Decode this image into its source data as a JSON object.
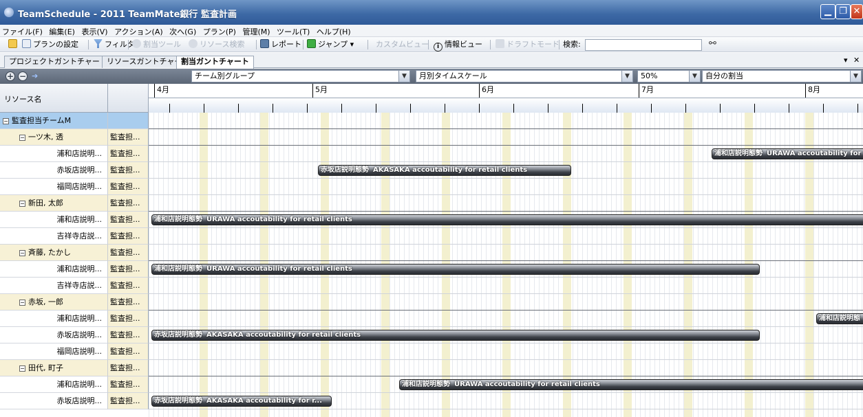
{
  "window": {
    "title": "TeamSchedule - 2011 TeamMate銀行 監査計画"
  },
  "menu": [
    "ファイル(F)",
    "編集(E)",
    "表示(V)",
    "アクション(A)",
    "次へ(G)",
    "プラン(P)",
    "管理(M)",
    "ツール(T)",
    "ヘルプ(H)"
  ],
  "toolbar": {
    "plan_settings": "プランの設定",
    "filter": "フィルタ",
    "allocation_tool": "割当ツール",
    "resource_search": "リソース検索",
    "report": "レポート",
    "jump": "ジャンプ ▾",
    "custom_view": "カスタムビュー",
    "info_view": "情報ビュー",
    "draft_mode": "ドラフトモード",
    "search_label": "検索:",
    "search_value": ""
  },
  "tabs": [
    {
      "label": "プロジェクトガントチャート"
    },
    {
      "label": "リソースガントチャート"
    },
    {
      "label": "割当ガントチャート"
    }
  ],
  "options": {
    "group": "チーム別グループ",
    "timescale": "月別タイムスケール",
    "zoom": "50%",
    "assignment": "自分の割当"
  },
  "left_header": {
    "resource_name": "リソース名"
  },
  "rows": [
    {
      "level": 0,
      "name": "監査担当チームM",
      "col2": ""
    },
    {
      "level": 1,
      "name": "一ツ木, 透",
      "col2": "監査担..."
    },
    {
      "level": 2,
      "name": "浦和店説明...",
      "col2": "監査担..."
    },
    {
      "level": 2,
      "name": "赤坂店説明...",
      "col2": "監査担..."
    },
    {
      "level": 2,
      "name": "福岡店説明...",
      "col2": "監査担..."
    },
    {
      "level": 1,
      "name": "新田, 太郎",
      "col2": "監査担..."
    },
    {
      "level": 2,
      "name": "浦和店説明...",
      "col2": "監査担..."
    },
    {
      "level": 2,
      "name": "吉祥寺店説...",
      "col2": "監査担..."
    },
    {
      "level": 1,
      "name": "斉藤, たかし",
      "col2": "監査担..."
    },
    {
      "level": 2,
      "name": "浦和店説明...",
      "col2": "監査担..."
    },
    {
      "level": 2,
      "name": "吉祥寺店説...",
      "col2": "監査担..."
    },
    {
      "level": 1,
      "name": "赤坂, 一郎",
      "col2": "監査担..."
    },
    {
      "level": 2,
      "name": "浦和店説明...",
      "col2": "監査担..."
    },
    {
      "level": 2,
      "name": "赤坂店説明...",
      "col2": "監査担..."
    },
    {
      "level": 2,
      "name": "福岡店説明...",
      "col2": "監査担..."
    },
    {
      "level": 1,
      "name": "田代, 町子",
      "col2": "監査担..."
    },
    {
      "level": 2,
      "name": "浦和店説明...",
      "col2": "監査担..."
    },
    {
      "level": 2,
      "name": "赤坂店説明...",
      "col2": "監査担..."
    }
  ],
  "timeline": {
    "months": [
      "4月",
      "5月",
      "6月",
      "7月",
      "8月"
    ]
  },
  "bars": [
    {
      "row": 2,
      "name": "浦和店説明態勢",
      "desc": "URAWA accoutability for retail clients"
    },
    {
      "row": 3,
      "name": "赤坂店説明態勢",
      "desc": "AKASAKA accoutability for retail clients"
    },
    {
      "row": 6,
      "name": "浦和店説明態勢",
      "desc": "URAWA accoutability for retail clients"
    },
    {
      "row": 9,
      "name": "浦和店説明態勢",
      "desc": "URAWA accoutability for retail clients"
    },
    {
      "row": 12,
      "name": "浦和店説明態",
      "desc": ""
    },
    {
      "row": 13,
      "name": "赤坂店説明態勢",
      "desc": "AKASAKA accoutability for retail clients"
    },
    {
      "row": 16,
      "name": "浦和店説明態勢",
      "desc": "URAWA accoutability for retail clients"
    },
    {
      "row": 17,
      "name": "赤坂店説明態勢",
      "desc": "AKASAKA accoutability for r..."
    }
  ]
}
